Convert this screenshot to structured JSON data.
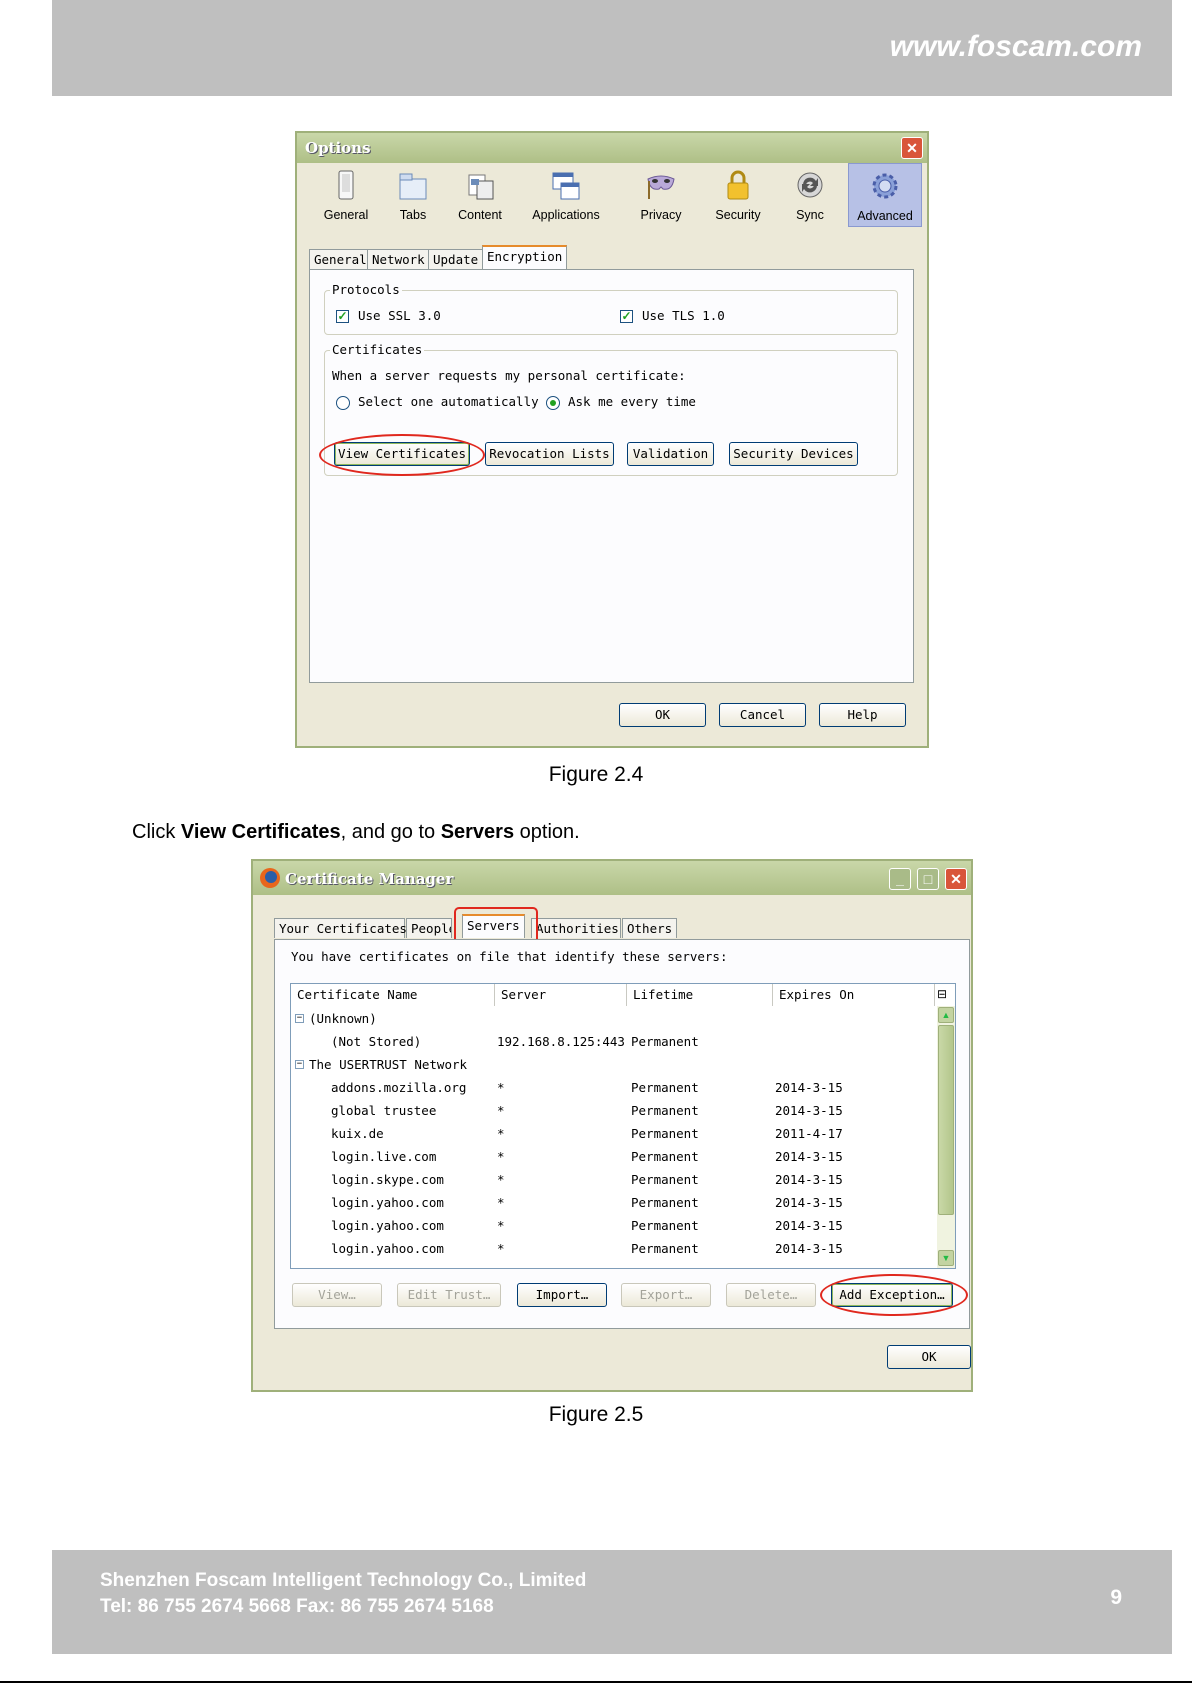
{
  "header": {
    "url": "www.foscam.com"
  },
  "footer": {
    "company": "Shenzhen Foscam Intelligent Technology Co., Limited",
    "contact": "Tel: 86 755 2674 5668 Fax: 86 755 2674 5168",
    "page_number": "9"
  },
  "captions": {
    "fig1": "Figure 2.4",
    "fig2": "Figure 2.5"
  },
  "instruction": {
    "pre": "Click ",
    "b1": "View Certificates",
    "mid": ", and go to ",
    "b2": "Servers",
    "post": " option."
  },
  "options_dialog": {
    "title": "Options",
    "categories": [
      "General",
      "Tabs",
      "Content",
      "Applications",
      "Privacy",
      "Security",
      "Sync",
      "Advanced"
    ],
    "selected_category": "Advanced",
    "tabs": [
      "General",
      "Network",
      "Update",
      "Encryption"
    ],
    "active_tab": "Encryption",
    "protocols": {
      "label": "Protocols",
      "ssl": {
        "label": "Use SSL 3.0",
        "checked": true
      },
      "tls": {
        "label": "Use TLS 1.0",
        "checked": true
      }
    },
    "certificates": {
      "label": "Certificates",
      "prompt": "When a server requests my personal certificate:",
      "option_auto": "Select one automatically",
      "option_ask": "Ask me every time",
      "selected_option": "Ask me every time",
      "buttons": [
        "View Certificates",
        "Revocation Lists",
        "Validation",
        "Security Devices"
      ]
    },
    "footer_buttons": {
      "ok": "OK",
      "cancel": "Cancel",
      "help": "Help"
    }
  },
  "cert_manager": {
    "title": "Certificate Manager",
    "tabs": [
      "Your Certificates",
      "People",
      "Servers",
      "Authorities",
      "Others"
    ],
    "active_tab": "Servers",
    "description": "You have certificates on file that identify these servers:",
    "columns": [
      "Certificate Name",
      "Server",
      "Lifetime",
      "Expires On"
    ],
    "groups": [
      {
        "name": "(Unknown)",
        "rows": [
          {
            "name": "(Not Stored)",
            "server": "192.168.8.125:443",
            "lifetime": "Permanent",
            "expires": ""
          }
        ]
      },
      {
        "name": "The USERTRUST Network",
        "rows": [
          {
            "name": "addons.mozilla.org",
            "server": "*",
            "lifetime": "Permanent",
            "expires": "2014-3-15"
          },
          {
            "name": "global trustee",
            "server": "*",
            "lifetime": "Permanent",
            "expires": "2014-3-15"
          },
          {
            "name": "kuix.de",
            "server": "*",
            "lifetime": "Permanent",
            "expires": "2011-4-17"
          },
          {
            "name": "login.live.com",
            "server": "*",
            "lifetime": "Permanent",
            "expires": "2014-3-15"
          },
          {
            "name": "login.skype.com",
            "server": "*",
            "lifetime": "Permanent",
            "expires": "2014-3-15"
          },
          {
            "name": "login.yahoo.com",
            "server": "*",
            "lifetime": "Permanent",
            "expires": "2014-3-15"
          },
          {
            "name": "login.yahoo.com",
            "server": "*",
            "lifetime": "Permanent",
            "expires": "2014-3-15"
          },
          {
            "name": "login.yahoo.com",
            "server": "*",
            "lifetime": "Permanent",
            "expires": "2014-3-15"
          }
        ]
      }
    ],
    "buttons": {
      "view": "View…",
      "edit_trust": "Edit Trust…",
      "import": "Import…",
      "export": "Export…",
      "delete": "Delete…",
      "add_exception": "Add Exception…"
    },
    "ok": "OK"
  }
}
